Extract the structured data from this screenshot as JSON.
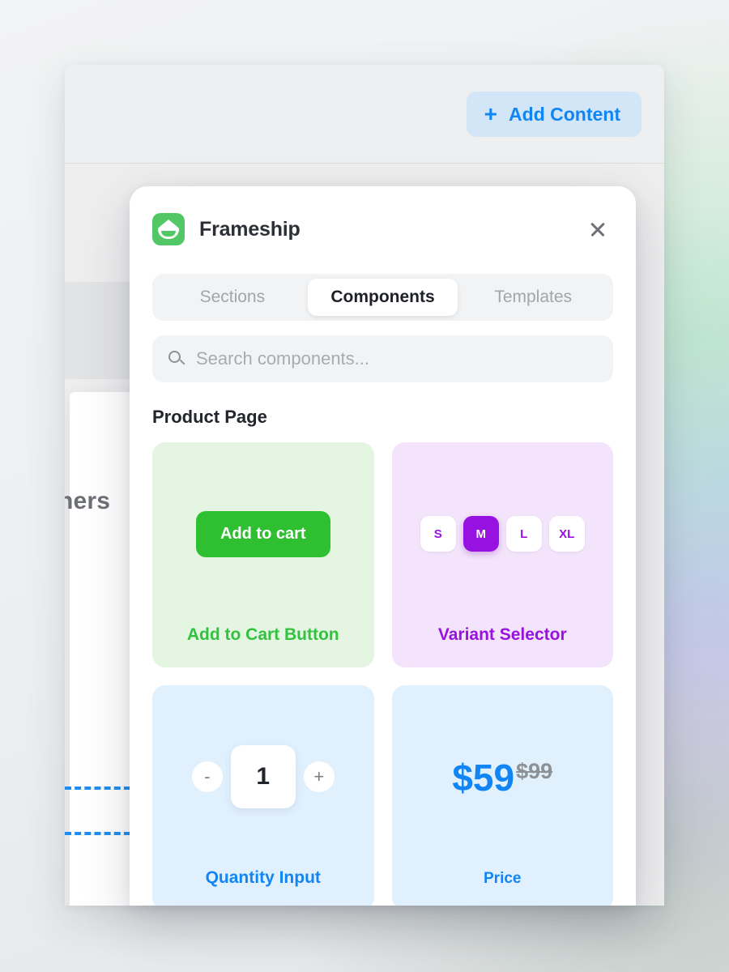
{
  "app": {
    "toolbar": {
      "add_content_label": "Add Content",
      "add_icon": "plus-icon"
    },
    "canvas": {
      "heading_partial": "ners",
      "dropzone": "drop-zone-indicator"
    }
  },
  "modal": {
    "brand": {
      "name": "Frameship",
      "logo_icon": "basket-logo-icon"
    },
    "close_icon": "close-icon",
    "tabs": [
      {
        "label": "Sections",
        "active": false
      },
      {
        "label": "Components",
        "active": true
      },
      {
        "label": "Templates",
        "active": false
      }
    ],
    "search": {
      "icon": "search-icon",
      "placeholder": "Search components...",
      "value": ""
    },
    "section_title": "Product Page",
    "components": [
      {
        "label": "Add to Cart Button",
        "theme": "green",
        "button_label": "Add to cart"
      },
      {
        "label": "Variant Selector",
        "theme": "purple",
        "variants": [
          "S",
          "M",
          "L",
          "XL"
        ],
        "selected_variant": "M"
      },
      {
        "label": "Quantity Input",
        "theme": "blue",
        "decrement_label": "-",
        "value": "1",
        "increment_label": "+"
      },
      {
        "label": "Price",
        "theme": "blue",
        "current_price": "$59",
        "old_price": "$99"
      }
    ]
  },
  "colors": {
    "brand_green": "#52c766",
    "accent_blue": "#1285f5",
    "accent_purple": "#9712e0",
    "accent_green": "#2fc032"
  }
}
